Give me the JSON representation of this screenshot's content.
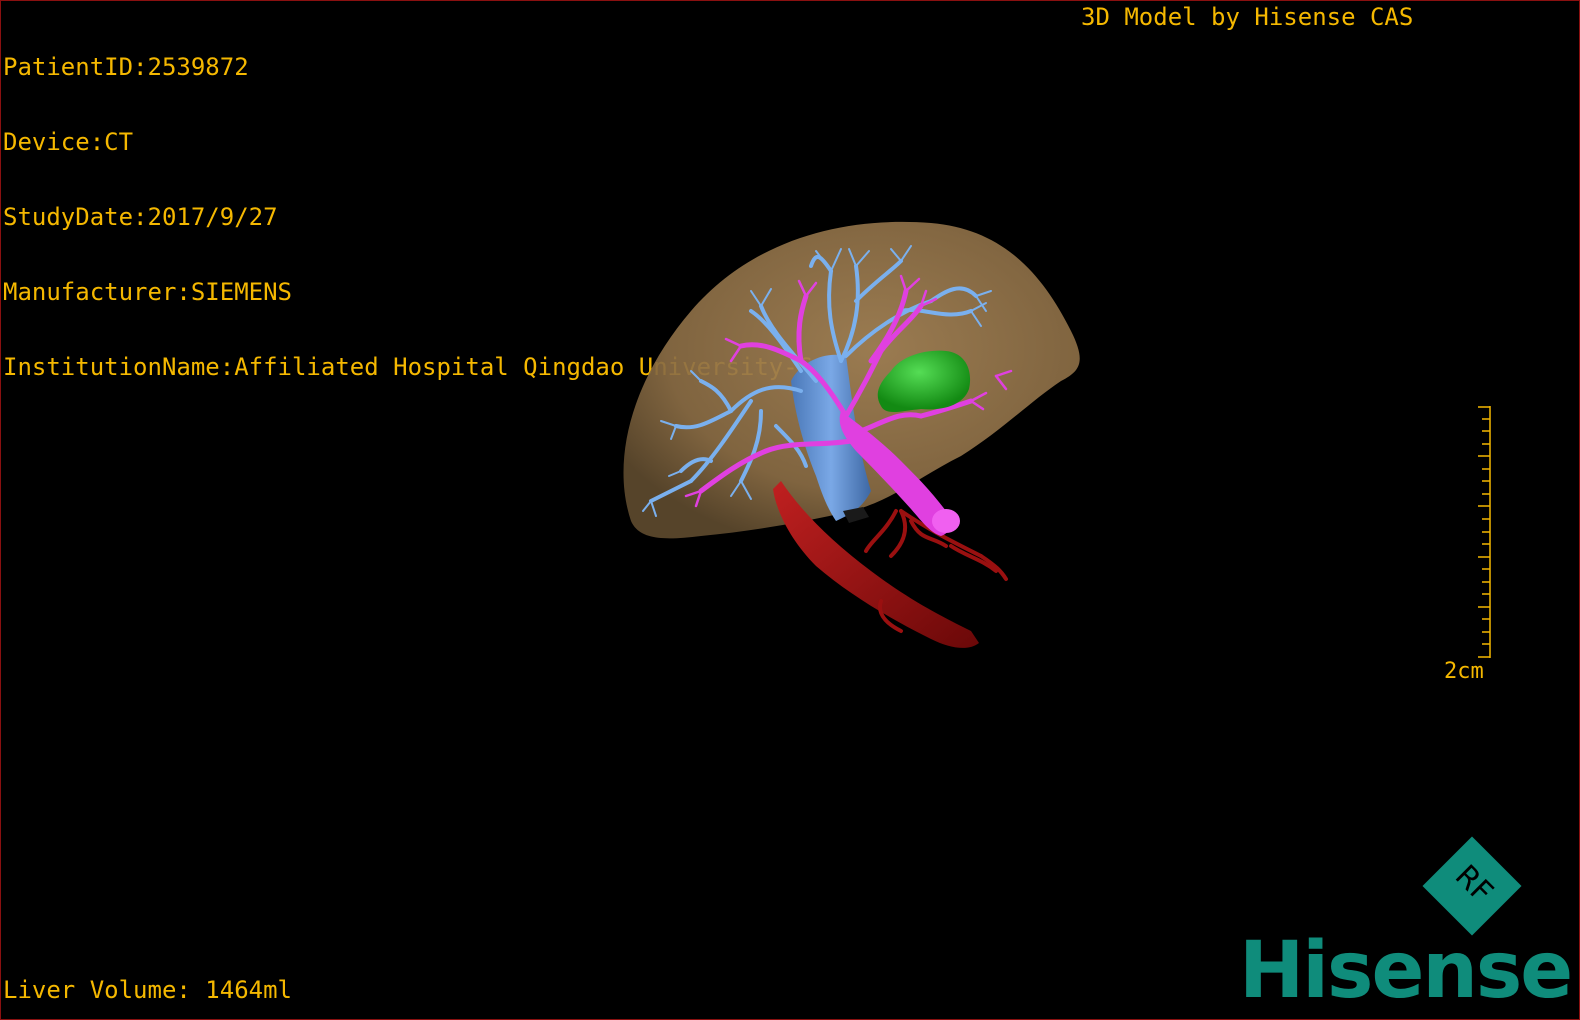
{
  "study_info": {
    "patient_id": "PatientID:2539872",
    "device": "Device:CT",
    "study_date": "StudyDate:2017/9/27",
    "manufacturer": "Manufacturer:SIEMENS",
    "institution": "InstitutionName:Affiliated Hospital Qingdao University-C"
  },
  "model_credit": "3D Model by Hisense CAS",
  "liver_volume": "Liver Volume: 1464ml",
  "scale": {
    "label": "2cm"
  },
  "branding": {
    "logo_letters": "RF",
    "name": "Hisense"
  },
  "colors": {
    "overlay_text": "#f5b800",
    "liver": "#8b6d45",
    "hepatic_vein": "#6a9ad6",
    "portal_vein": "#e040e0",
    "artery_ivc": "#a01010",
    "gallbladder": "#22aa22",
    "brand": "#0f8c7b",
    "viewport_border": "#8a1010"
  }
}
